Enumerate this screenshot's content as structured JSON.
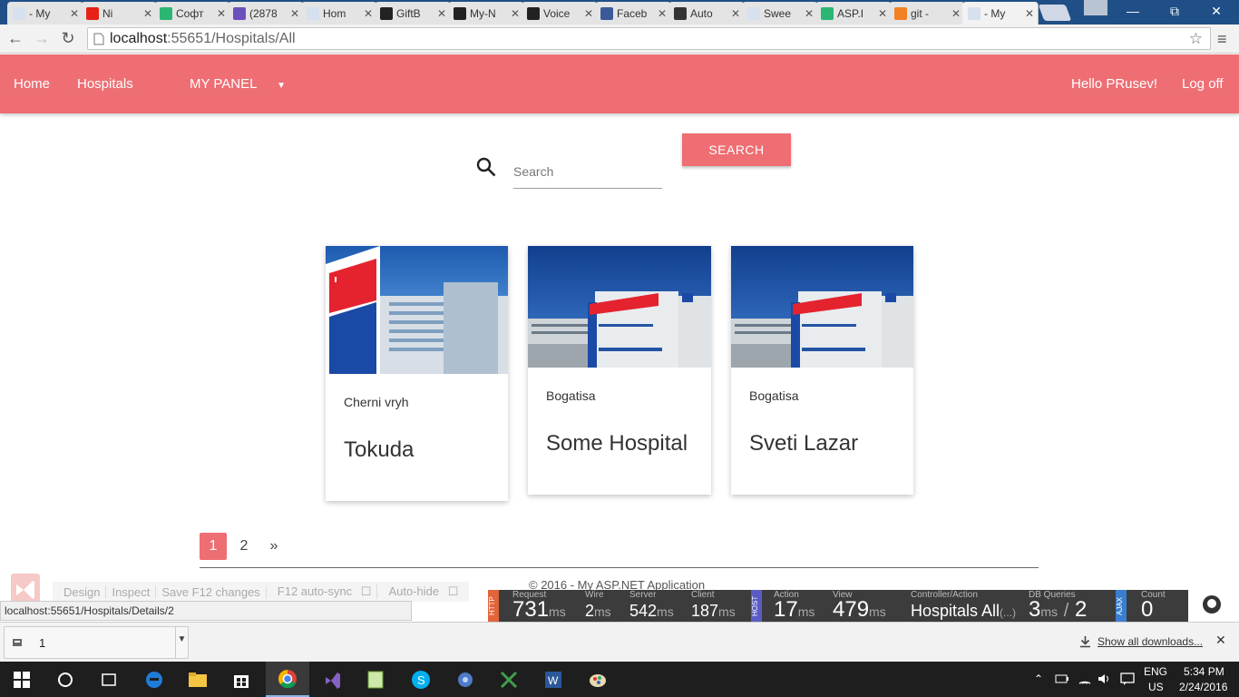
{
  "browser": {
    "tabs": [
      {
        "title": "- My",
        "color": "#d6e0ee"
      },
      {
        "title": "Ni",
        "color": "#e62117"
      },
      {
        "title": "Софт",
        "color": "#2bb673"
      },
      {
        "title": "(2878",
        "color": "#6b4fbb"
      },
      {
        "title": "Hom",
        "color": "#d6e0ee"
      },
      {
        "title": "GiftB",
        "color": "#222222"
      },
      {
        "title": "My-N",
        "color": "#222222"
      },
      {
        "title": "Voice",
        "color": "#222222"
      },
      {
        "title": "Faceb",
        "color": "#3b5998"
      },
      {
        "title": "Auto",
        "color": "#333333"
      },
      {
        "title": "Swee",
        "color": "#d6e0ee"
      },
      {
        "title": "ASP.I",
        "color": "#2bb673"
      },
      {
        "title": "git -",
        "color": "#f48024"
      },
      {
        "title": "- My",
        "color": "#d6e0ee"
      }
    ],
    "url_host": "localhost",
    "url_path": ":55651/Hospitals/All",
    "status_url": "localhost:55651/Hospitals/Details/2"
  },
  "nav": {
    "home": "Home",
    "hospitals": "Hospitals",
    "my_panel": "MY PANEL",
    "greeting": "Hello PRusev!",
    "logoff": "Log off"
  },
  "search": {
    "placeholder": "Search",
    "button": "SEARCH"
  },
  "hospitals": [
    {
      "location": "Cherni vryh",
      "name": "Tokuda"
    },
    {
      "location": "Bogatisa",
      "name": "Some Hospital"
    },
    {
      "location": "Bogatisa",
      "name": "Sveti Lazar"
    }
  ],
  "pagination": {
    "pages": [
      "1",
      "2"
    ],
    "next": "»",
    "active": "1"
  },
  "footer": "© 2016 - My ASP.NET Application",
  "browser_link": {
    "items": [
      "Design",
      "Inspect",
      "Save F12 changes",
      "F12 auto-sync",
      "Auto-hide"
    ]
  },
  "glimpse": {
    "http_tag": "HTTP",
    "host_tag": "HOST",
    "ajax_tag": "AJAX",
    "request": {
      "label": "Request",
      "value": "731",
      "unit": "ms"
    },
    "wire": {
      "label": "Wire",
      "value": "2",
      "unit": "ms"
    },
    "server": {
      "label": "Server",
      "value": "542",
      "unit": "ms"
    },
    "client": {
      "label": "Client",
      "value": "187",
      "unit": "ms"
    },
    "action": {
      "label": "Action",
      "value": "17",
      "unit": "ms"
    },
    "view": {
      "label": "View",
      "value": "479",
      "unit": "ms"
    },
    "controller": {
      "label": "Controller/Action",
      "value": "Hospitals All",
      "suffix": "(...)"
    },
    "db": {
      "label": "DB Queries",
      "value": "3",
      "unit": "ms",
      "sep": "/",
      "count": "2"
    },
    "count": {
      "label": "Count",
      "value": "0"
    }
  },
  "downloads": {
    "item": "1",
    "show_all": "Show all downloads..."
  },
  "taskbar": {
    "lang1": "ENG",
    "lang2": "US",
    "time": "5:34 PM",
    "date": "2/24/2016"
  },
  "colors": {
    "accent": "#ee6e73",
    "tabbar": "#1f4f86"
  }
}
